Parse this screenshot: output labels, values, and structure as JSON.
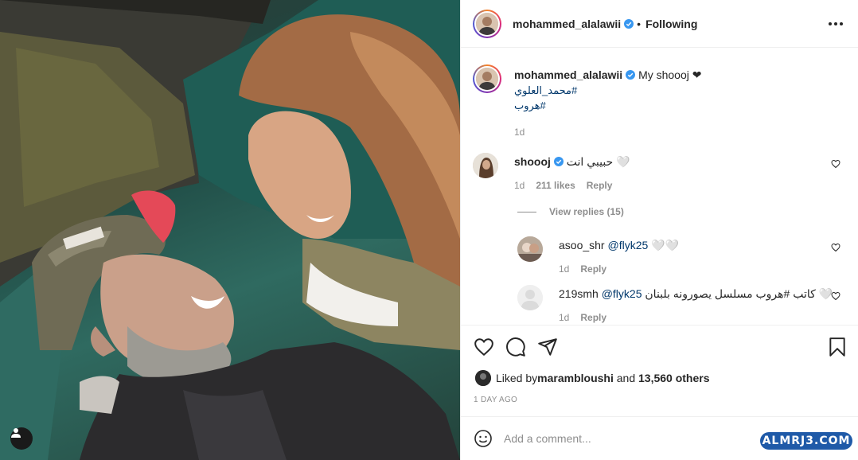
{
  "post": {
    "author": "mohammed_alalawii",
    "follow_status": "Following",
    "separator": "•"
  },
  "caption": {
    "author": "mohammed_alalawii",
    "text": "My shoooj ❤",
    "hashtags": [
      "#محمد_العلوي",
      "#هروب"
    ],
    "time": "1d"
  },
  "comments": [
    {
      "author": "shoooj",
      "verified": true,
      "text": "حبيبي انت 🤍",
      "time": "1d",
      "likes": "211 likes",
      "reply_label": "Reply",
      "view_replies": "View replies (15)"
    },
    {
      "author": "asoo_shr",
      "mention": "@flyk25",
      "text": " 🤍🤍",
      "time": "1d",
      "reply_label": "Reply"
    },
    {
      "author": "219smh",
      "mention": "@flyk25",
      "text": " كاتب #هروب مسلسل يصورونه بلبنان 🤍",
      "time": "1d",
      "reply_label": "Reply"
    }
  ],
  "likes": {
    "prefix": "Liked by ",
    "user": "marambloushi",
    "middle": " and ",
    "others": "13,560 others"
  },
  "post_time": "1 DAY AGO",
  "add_comment": {
    "placeholder": "Add a comment..."
  },
  "watermark": "ALMRJ3.COM",
  "colors": {
    "verified": "#3897f0",
    "hashtag": "#00376b",
    "muted": "#8e8e8e",
    "border": "#efefef",
    "watermark_bg": "#1f5aa8"
  },
  "icons": [
    "heart-icon",
    "comment-icon",
    "share-icon",
    "bookmark-icon",
    "more-icon",
    "emoji-icon",
    "user-tag-icon",
    "verified-icon"
  ]
}
